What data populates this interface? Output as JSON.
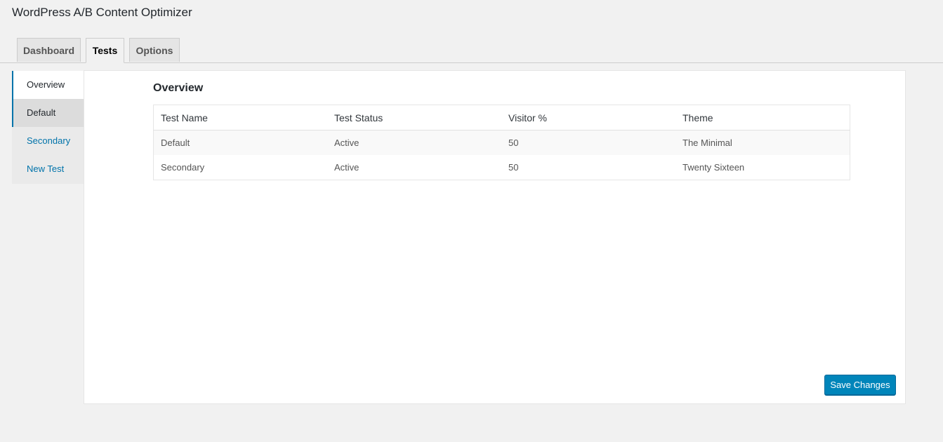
{
  "app": {
    "title": "WordPress A/B Content Optimizer"
  },
  "tabs": [
    {
      "label": "Dashboard",
      "active": false
    },
    {
      "label": "Tests",
      "active": true
    },
    {
      "label": "Options",
      "active": false
    }
  ],
  "side_menu": {
    "items": [
      {
        "label": "Overview",
        "state": "active"
      },
      {
        "label": "Default",
        "state": "hover"
      },
      {
        "label": "Secondary",
        "state": "link"
      },
      {
        "label": "New Test",
        "state": "link"
      }
    ]
  },
  "main": {
    "heading": "Overview",
    "table": {
      "columns": [
        "Test Name",
        "Test Status",
        "Visitor %",
        "Theme"
      ],
      "rows": [
        [
          "Default",
          "Active",
          "50",
          "The Minimal"
        ],
        [
          "Secondary",
          "Active",
          "50",
          "Twenty Sixteen"
        ]
      ]
    },
    "save_label": "Save Changes"
  },
  "colors": {
    "accent": "#0073aa",
    "button": "#0085ba",
    "background": "#f1f1f1"
  }
}
